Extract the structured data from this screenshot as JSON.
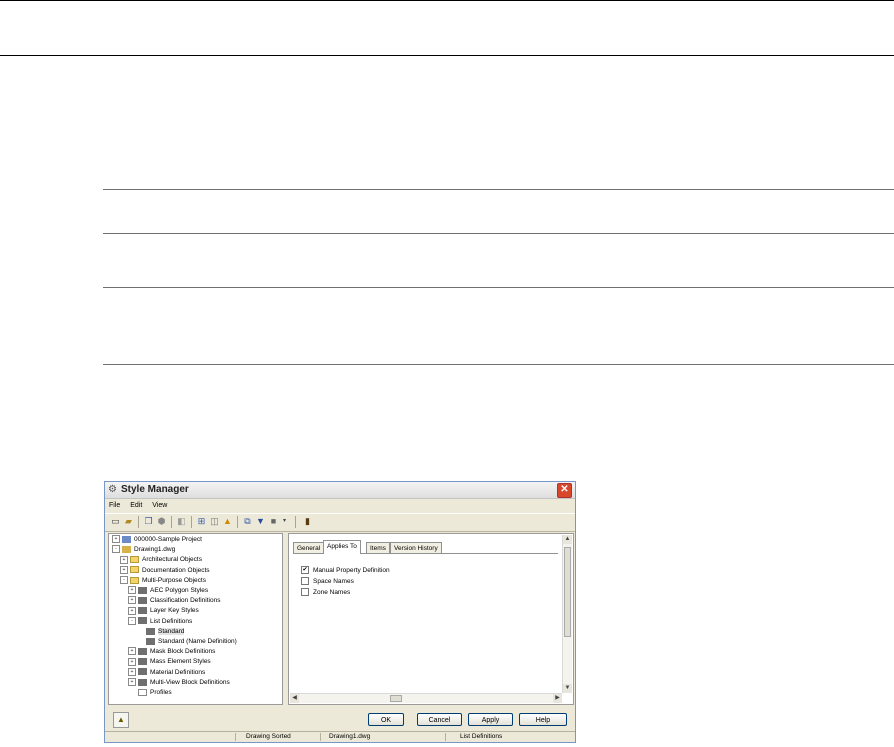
{
  "window": {
    "title": "Style Manager",
    "close_glyph": "✕",
    "menus": [
      "File",
      "Edit",
      "View"
    ]
  },
  "toolbar": {
    "icons": [
      "new-icon",
      "open-icon",
      "copy-icon",
      "paste-icon",
      "purge-icon",
      "add-icon",
      "duplicate-icon",
      "warning-icon",
      "compare-icon",
      "filter-icon",
      "view-icon",
      "dropdown-icon",
      "help-book-icon"
    ]
  },
  "tree": {
    "items": [
      {
        "label": "000000-Sample Project",
        "level": 0,
        "expander": "+",
        "icon": "project-icon"
      },
      {
        "label": "Drawing1.dwg",
        "level": 0,
        "expander": "-",
        "icon": "drawing-icon"
      },
      {
        "label": "Architectural Objects",
        "level": 1,
        "expander": "+",
        "icon": "folder-icon"
      },
      {
        "label": "Documentation Objects",
        "level": 1,
        "expander": "+",
        "icon": "folder-icon"
      },
      {
        "label": "Multi-Purpose Objects",
        "level": 1,
        "expander": "-",
        "icon": "folder-icon"
      },
      {
        "label": "AEC Polygon Styles",
        "level": 2,
        "expander": "+",
        "icon": "style-icon"
      },
      {
        "label": "Classification Definitions",
        "level": 2,
        "expander": "+",
        "icon": "style-icon"
      },
      {
        "label": "Layer Key Styles",
        "level": 2,
        "expander": "+",
        "icon": "style-icon"
      },
      {
        "label": "List Definitions",
        "level": 2,
        "expander": "-",
        "icon": "list-icon"
      },
      {
        "label": "Standard",
        "level": 3,
        "expander": "",
        "icon": "list-icon",
        "selected": true
      },
      {
        "label": "Standard (Name Definition)",
        "level": 3,
        "expander": "",
        "icon": "list-icon"
      },
      {
        "label": "Mask Block Definitions",
        "level": 2,
        "expander": "+",
        "icon": "style-icon"
      },
      {
        "label": "Mass Element Styles",
        "level": 2,
        "expander": "+",
        "icon": "style-icon"
      },
      {
        "label": "Material Definitions",
        "level": 2,
        "expander": "+",
        "icon": "style-icon"
      },
      {
        "label": "Multi-View Block Definitions",
        "level": 2,
        "expander": "+",
        "icon": "style-icon"
      },
      {
        "label": "Profiles",
        "level": 2,
        "expander": "",
        "icon": "profile-icon"
      }
    ]
  },
  "tabs": [
    {
      "label": "General",
      "active": false
    },
    {
      "label": "Applies To",
      "active": true
    },
    {
      "label": "Items",
      "active": false
    },
    {
      "label": "Version History",
      "active": false
    }
  ],
  "applies_to": [
    {
      "label": "Manual Property Definition",
      "checked": true
    },
    {
      "label": "Space Names",
      "checked": false
    },
    {
      "label": "Zone Names",
      "checked": false
    }
  ],
  "buttons": {
    "ok": "OK",
    "cancel": "Cancel",
    "apply": "Apply",
    "help": "Help"
  },
  "status": {
    "sort": "Drawing Sorted",
    "file": "Drawing1.dwg",
    "selection": "List Definitions"
  },
  "colors": {
    "close": "#d9472b",
    "window_bg": "#ece9d8",
    "button_border": "#003c74"
  }
}
